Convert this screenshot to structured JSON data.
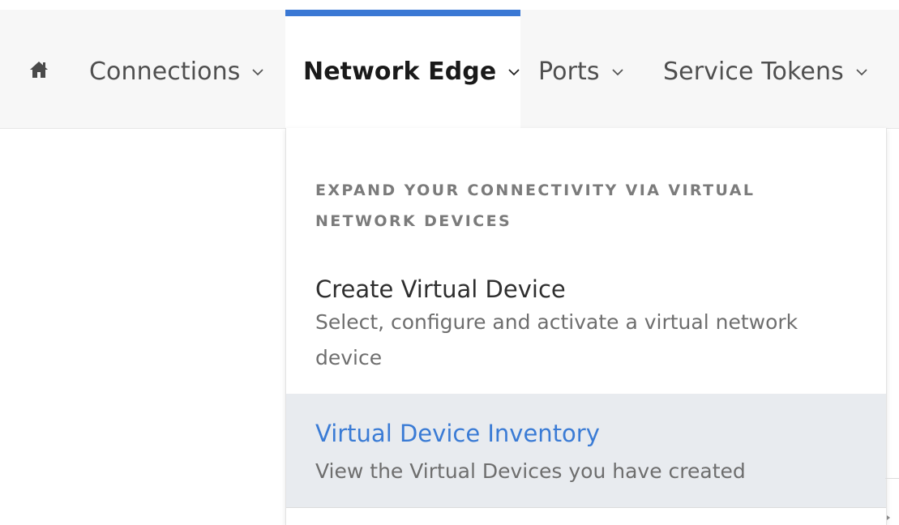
{
  "nav": {
    "home_icon": "home-icon",
    "items": [
      {
        "label": "Connections",
        "icon": "chevron-down-icon"
      },
      {
        "label": "Network Edge",
        "icon": "chevron-down-icon",
        "active": true
      },
      {
        "label": "Ports",
        "icon": "chevron-down-icon"
      },
      {
        "label": "Service Tokens",
        "icon": "chevron-down-icon"
      }
    ],
    "active_color": "#3a78d4"
  },
  "dropdown": {
    "heading": "EXPAND YOUR CONNECTIVITY VIA VIRTUAL NETWORK DEVICES",
    "items": [
      {
        "title": "Create Virtual Device",
        "description": "Select, configure and activate a virtual network device"
      },
      {
        "title": "Virtual Device Inventory",
        "description": "View the Virtual Devices you have created",
        "highlighted": true
      }
    ],
    "link_color": "#3a7bd5",
    "highlight_bg": "#e8ebef"
  }
}
